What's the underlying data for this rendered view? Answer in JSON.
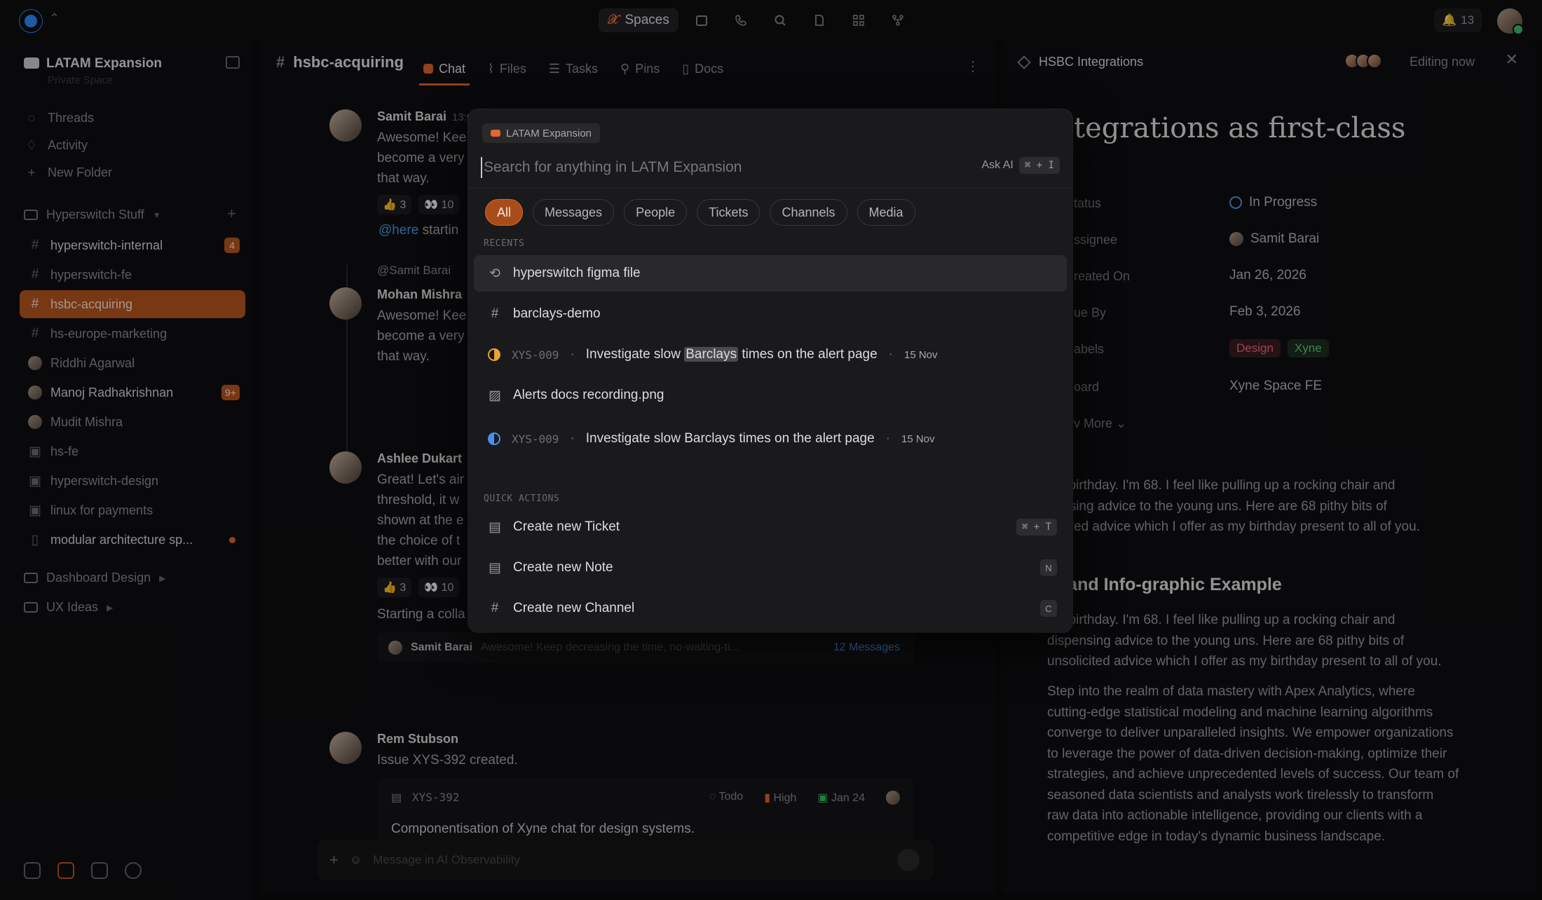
{
  "topbar": {
    "spaces_label": "Spaces",
    "notif_count": "13"
  },
  "sidebar": {
    "workspace": "LATAM Expansion",
    "workspace_sub": "Private Space",
    "nav": [
      {
        "label": "Threads"
      },
      {
        "label": "Activity"
      },
      {
        "label": "New Folder"
      }
    ],
    "folder": "Hyperswitch Stuff",
    "channels": [
      {
        "label": "hyperswitch-internal",
        "badge": "4"
      },
      {
        "label": "hyperswitch-fe"
      },
      {
        "label": "hsbc-acquiring"
      },
      {
        "label": "hs-europe-marketing"
      },
      {
        "label": "Riddhi Agarwal"
      },
      {
        "label": "Manoj Radhakrishnan",
        "badge": "9+"
      },
      {
        "label": "Mudit Mishra"
      },
      {
        "label": "hs-fe"
      },
      {
        "label": "hyperswitch-design"
      },
      {
        "label": "linux for payments"
      },
      {
        "label": "modular architecture sp..."
      }
    ],
    "folders2": [
      {
        "label": "Dashboard Design"
      },
      {
        "label": "UX Ideas"
      }
    ]
  },
  "chat": {
    "channel": "hsbc-acquiring",
    "tabs": [
      {
        "label": "Chat"
      },
      {
        "label": "Files"
      },
      {
        "label": "Tasks"
      },
      {
        "label": "Pins"
      },
      {
        "label": "Docs"
      }
    ],
    "m1": {
      "name": "Samit Barai",
      "time": "13:0",
      "l1": "Awesome! Kee",
      "l2": "become a very",
      "l3": "that way.",
      "r1": "👍 3",
      "r2": "👀 10"
    },
    "mention": "@here",
    "mention_after": "startin",
    "reply_to": "@Samit Barai",
    "m2": {
      "name": "Mohan Mishra",
      "l1": "Awesome! Kee",
      "l2": "become a very",
      "l3": "that way."
    },
    "m3": {
      "name": "Ashlee Dukart",
      "l1": "Great! Let's air",
      "l2": "threshold, it w",
      "l3": "shown at the e",
      "l4": "the choice of t",
      "l5": "better with our",
      "r1": "👍 3",
      "r2": "👀 10",
      "l6": "Starting a colla"
    },
    "thread": {
      "name": "Samit Barai",
      "snippet": "Awesome! Keep decreasing the time, no-waiting-ti...",
      "count": "12 Messages"
    },
    "m4": {
      "name": "Rem Stubson",
      "body": "Issue XYS-392 created."
    },
    "issue": {
      "id": "XYS-392",
      "status": "Todo",
      "priority": "High",
      "date": "Jan 24",
      "title": "Componentisation of Xyne chat for design systems."
    },
    "composer_placeholder": "Message in AI Observability"
  },
  "right": {
    "title": "HSBC Integrations",
    "editing": "Editing now",
    "heading": "tegrations as first-class",
    "props": [
      {
        "k": "tatus",
        "v": "In Progress"
      },
      {
        "k": "ssignee",
        "v": "Samit Barai"
      },
      {
        "k": "reated On",
        "v": "Jan 26, 2026"
      },
      {
        "k": "ue By",
        "v": "Feb 3, 2026"
      },
      {
        "k": "abels"
      },
      {
        "k": "oard",
        "v": "Xyne Space FE"
      }
    ],
    "labels": [
      "Design",
      "Xyne"
    ],
    "more": "v More",
    "p1": [
      "my birthday. I'm 68. I feel like pulling up a rocking chair and",
      "pensing advice to the young uns. Here are 68 pithy bits of",
      "olicited advice which I offer as my birthday present to all of you."
    ],
    "h2": "xt and Info-graphic Example",
    "p2": [
      "my birthday. I'm 68. I feel like pulling up a rocking chair and",
      "dispensing advice to the young uns. Here are 68 pithy bits of",
      "unsolicited advice which I offer as my birthday present to all of you."
    ],
    "p3": [
      "Step into the realm of data mastery with Apex Analytics, where",
      "cutting-edge statistical modeling and machine learning algorithms",
      "converge to deliver unparalleled insights. We empower organizations",
      "to leverage the power of data-driven decision-making, optimize their",
      "strategies, and achieve unprecedented levels of success. Our team of",
      "seasoned data scientists and analysts work tirelessly to transform",
      "raw data into actionable intelligence, providing our clients with a",
      "competitive edge in today's dynamic business landscape."
    ]
  },
  "palette": {
    "scope": "LATAM Expansion",
    "placeholder": "Search for anything in LATM Expansion",
    "ask_ai": "Ask AI",
    "ask_kbd": "⌘ + I",
    "filters": [
      "All",
      "Messages",
      "People",
      "Tickets",
      "Channels",
      "Media"
    ],
    "recents_label": "RECENTS",
    "recents": [
      {
        "label": "hyperswitch figma file"
      },
      {
        "label": "barclays-demo"
      },
      {
        "id": "XYS-009",
        "pre": "Investigate slow ",
        "mark": "Barclays",
        "post": " times on the alert page",
        "date": "15 Nov"
      },
      {
        "label": "Alerts docs recording.png"
      },
      {
        "id": "XYS-009",
        "label": "Investigate slow Barclays times on the alert page",
        "date": "15 Nov"
      }
    ],
    "quick_label": "QUICK ACTIONS",
    "actions": [
      {
        "label": "Create new Ticket",
        "kbd": "⌘ + T"
      },
      {
        "label": "Create new Note",
        "kbd": "N"
      },
      {
        "label": "Create new Channel",
        "kbd": "C"
      }
    ]
  }
}
